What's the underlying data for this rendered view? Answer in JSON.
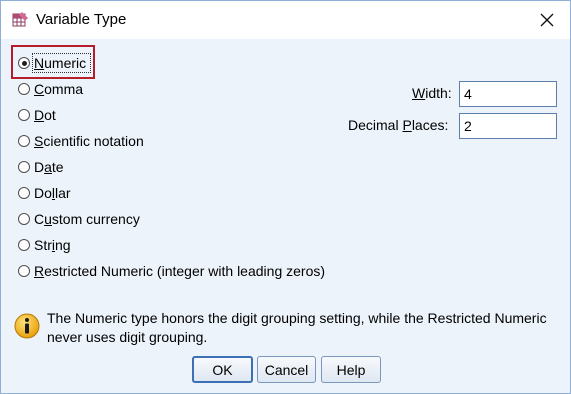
{
  "window": {
    "title": "Variable Type"
  },
  "type_options": [
    {
      "pre": "",
      "key": "N",
      "post": "umeric",
      "checked": true
    },
    {
      "pre": "",
      "key": "C",
      "post": "omma",
      "checked": false
    },
    {
      "pre": "",
      "key": "D",
      "post": "ot",
      "checked": false
    },
    {
      "pre": "",
      "key": "S",
      "post": "cientific notation",
      "checked": false
    },
    {
      "pre": "D",
      "key": "a",
      "post": "te",
      "checked": false
    },
    {
      "pre": "Do",
      "key": "l",
      "post": "lar",
      "checked": false
    },
    {
      "pre": "C",
      "key": "u",
      "post": "stom currency",
      "checked": false
    },
    {
      "pre": "Str",
      "key": "i",
      "post": "ng",
      "checked": false
    },
    {
      "pre": "",
      "key": "R",
      "post": "estricted Numeric (integer with leading zeros)",
      "checked": false
    }
  ],
  "width_field": {
    "label_key": "W",
    "label_rest": "idth:",
    "value": "4"
  },
  "decimal_field": {
    "label_pre": "Decimal ",
    "label_key": "P",
    "label_rest": "laces:",
    "value": "2"
  },
  "info": {
    "text": "The Numeric type honors the digit grouping setting, while the Restricted Numeric never uses digit grouping."
  },
  "buttons": {
    "ok": "OK",
    "cancel": "Cancel",
    "help": "Help"
  }
}
